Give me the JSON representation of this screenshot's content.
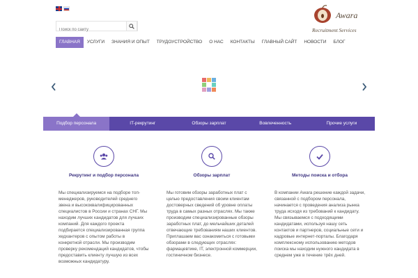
{
  "header": {
    "flags": [
      "uk-flag-icon",
      "ru-flag-icon"
    ],
    "search": {
      "placeholder": "Поиск по сайту",
      "icon": "search-icon"
    },
    "logo": {
      "name": "Awara",
      "subtitle": "Recruitment Services"
    }
  },
  "nav": {
    "items": [
      "ГЛАВНАЯ",
      "УСЛУГИ",
      "ЗНАНИЯ И ОПЫТ",
      "ТРУДОУСТРОЙСТВО",
      "О НАС",
      "КОНТАКТЫ",
      "ГЛАВНЫЙ САЙТ",
      "НОВОСТИ",
      "БЛОГ"
    ],
    "active_index": 0
  },
  "slider": {
    "prev_icon": "chevron-left-icon",
    "next_icon": "chevron-right-icon",
    "loader_icon": "loading-grid-icon"
  },
  "tabs": {
    "items": [
      "Подбор персонала",
      "IT-рекрутинг",
      "Обзоры зарплат",
      "Вовлеченность",
      "Прочие услуги"
    ],
    "active_index": 0
  },
  "features": [
    {
      "icon": "users-icon",
      "title": "Рекрутинг и подбор персонала",
      "text": "Мы специализируемся на подборе топ-менеджеров, руководителей среднего звена и высококвалифицированных специалистов в России и странах СНГ. Мы находим лучших кандидатов для лучших компаний. Для каждого проекта подбирается специализированная группа хедхантеров с опытом работы в конкретной отрасли. Мы производим проверку рекомендаций кандидатов, чтобы предоставить клиенту лучшую из всех возможных кандидатуру."
    },
    {
      "icon": "search-icon",
      "title": "Обзоры зарплат",
      "text": "Мы готовим обзоры заработных плат с целью предоставления своим клиентам достоверных сведений об уровне оплаты труда в самых разных отраслях. Мы также производим специализированные обзоры заработных плат, до мельчайших деталей отвечающие требованиям наших клиентов. Приглашаем вас ознакомиться с готовыми обзорами в следующих отраслях: фармацевтике, IT, электронной коммерции, гостиничном бизнесе."
    },
    {
      "icon": "checkmark-icon",
      "title": "Методы поиска и отбора",
      "text": "В компании Awara решение каждой задачи, связанной с подбором персонала, начинается с проведения анализа рынка труда исходя из требований к кандидату. Мы связываемся с подходящими кандидатами, используя нашу сеть контактов и партнеров, социальные сети и кадровые интернет-порталы. Благодаря комплексному использованию методов поиска мы находим нужного кандидата в среднем уже в течение трёх дней."
    }
  ],
  "colors": {
    "brand_purple": "#5a48a8",
    "active_purple": "#8a74c8",
    "heading": "#3d3380",
    "arrow": "#3a5a78",
    "loader": [
      "#e86a6a",
      "#f0b85a",
      "#6ab0e0",
      "#8fcf7a",
      "#b78be0",
      "#6ad0c0",
      "#e0a0c0",
      "#a0a0e0",
      "#f08a5a"
    ]
  }
}
